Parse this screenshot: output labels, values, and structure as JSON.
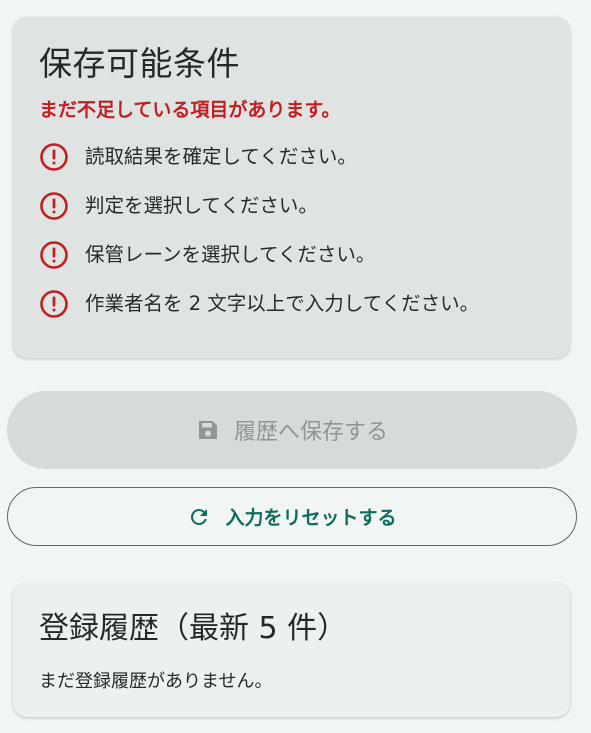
{
  "conditions": {
    "title": "保存可能条件",
    "warning": "まだ不足している項目があります。",
    "items": [
      {
        "icon": "alert-circle-icon",
        "text": "読取結果を確定してください。"
      },
      {
        "icon": "alert-circle-icon",
        "text": "判定を選択してください。"
      },
      {
        "icon": "alert-circle-icon",
        "text": "保管レーンを選択してください。"
      },
      {
        "icon": "alert-circle-icon",
        "text": "作業者名を 2 文字以上で入力してください。"
      }
    ]
  },
  "actions": {
    "save_label": "履歴へ保存する",
    "save_icon": "save-icon",
    "save_disabled": true,
    "reset_label": "入力をリセットする",
    "reset_icon": "refresh-icon"
  },
  "history": {
    "title": "登録履歴（最新 5 件）",
    "empty_text": "まだ登録履歴がありません。"
  },
  "colors": {
    "background": "#f1f6f4",
    "warning": "#c11f22",
    "accent": "#0f6b5d",
    "disabled": "#8f9693"
  }
}
